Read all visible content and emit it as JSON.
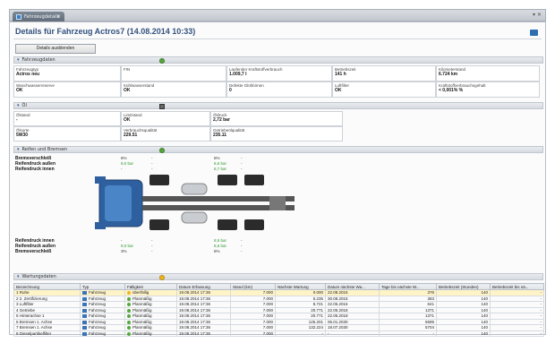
{
  "tab": {
    "label": "Fahrzeugdetails"
  },
  "header": {
    "title": "Details für Fahrzeug Actros7 (14.08.2014 10:33)"
  },
  "toolbar": {
    "details_label": "Details ausblenden"
  },
  "sections": {
    "vehicle": "Fahrzeugdaten",
    "oil": "Öl",
    "tires": "Reifen und Bremsen",
    "maintenance": "Wartungsdaten"
  },
  "vehicle_cells": [
    {
      "label": "Fahrzeugtyp",
      "value": "Actros neu"
    },
    {
      "label": "FIN",
      "value": ""
    },
    {
      "label": "Laufender Kraftstoffverbrauch",
      "value": "1.009,7 l"
    },
    {
      "label": "Betriebszeit",
      "value": "141 h"
    },
    {
      "label": "Kilometerstand",
      "value": "6.724 km"
    },
    {
      "label": "Waschwasserreserve",
      "value": "OK"
    },
    {
      "label": "Kühlwasserstand",
      "value": "OK"
    },
    {
      "label": "Defekte Glühbirnen",
      "value": "0"
    },
    {
      "label": "Luftfilter",
      "value": "OK"
    },
    {
      "label": "Kraftstoffverbrauchsgehalt",
      "value": "< 0,001% %"
    }
  ],
  "oil_cells": [
    {
      "label": "Ölstand",
      "value": "-"
    },
    {
      "label": "Limitstand",
      "value": "OK"
    },
    {
      "label": "Öldruck",
      "value": "2,72 bar"
    },
    {
      "label": "Ölsorte",
      "value": "5W30"
    },
    {
      "label": "Verbrauchsqualität",
      "value": "229.51"
    },
    {
      "label": "Getriebeölqualität",
      "value": "235.11"
    }
  ],
  "tires_top": [
    {
      "label": "Bremsverschleiß",
      "v1": "6%",
      "v1_green": false,
      "v2": "-",
      "v3": "5%",
      "v3_green": false,
      "v4": "-"
    },
    {
      "label": "Reifendruck außen",
      "v1": "8,0 bar",
      "v1_green": true,
      "v2": "-",
      "v3": "8,6 bar",
      "v3_green": true,
      "v4": "-"
    },
    {
      "label": "Reifendruck innen",
      "v1": "-",
      "v1_green": false,
      "v2": "-",
      "v3": "8,7 bar",
      "v3_green": true,
      "v4": "-"
    }
  ],
  "tires_bottom": [
    {
      "label": "Reifendruck innen",
      "v1": "-",
      "v1_green": false,
      "v2": "-",
      "v3": "8,5 bar",
      "v3_green": true,
      "v4": "-"
    },
    {
      "label": "Reifendruck außen",
      "v1": "9,0 bar",
      "v1_green": true,
      "v2": "-",
      "v3": "8,6 bar",
      "v3_green": true,
      "v4": "-"
    },
    {
      "label": "Bremsverschleiß",
      "v1": "3%",
      "v1_green": false,
      "v2": "-",
      "v3": "6%",
      "v3_green": false,
      "v4": "-"
    }
  ],
  "maintenance": {
    "columns": [
      "Bezeichnung",
      "Typ",
      "Fälligkeit",
      "Datum Erfassung",
      "Stand (km)",
      "Nächste Wartung",
      "Datum nächste Wa...",
      "Tage bis nächste W...",
      "Betriebszeit (Stunden)",
      "Betriebszeit bis nä..."
    ],
    "rows": [
      {
        "name": "Ruhe",
        "type": "Fahrzeug",
        "status": "überfällig",
        "warn": true,
        "date": "19.08.2014 17:36",
        "km": "7.000",
        "next": "0.000",
        "next_date": "22.08.2015",
        "days": "376",
        "hours": "140",
        "hours_left": "-"
      },
      {
        "name": "2. Zertifizierung",
        "type": "Fahrzeug",
        "status": "Planmäßig",
        "warn": false,
        "date": "19.08.2014 17:36",
        "km": "7.000",
        "next": "5.235",
        "next_date": "30.08.2015",
        "days": "383",
        "hours": "140",
        "hours_left": "-"
      },
      {
        "name": "Luftfilter",
        "type": "Fahrzeug",
        "status": "Planmäßig",
        "warn": false,
        "date": "19.08.2014 17:36",
        "km": "7.000",
        "next": "8.721",
        "next_date": "22.05.2016",
        "days": "641",
        "hours": "140",
        "hours_left": "-"
      },
      {
        "name": "Getriebe",
        "type": "Fahrzeug",
        "status": "Planmäßig",
        "warn": false,
        "date": "19.08.2014 17:36",
        "km": "7.000",
        "next": "20.771",
        "next_date": "22.05.2018",
        "days": "1371",
        "hours": "140",
        "hours_left": "-"
      },
      {
        "name": "Hinterachse 1",
        "type": "Fahrzeug",
        "status": "Planmäßig",
        "warn": false,
        "date": "19.08.2014 17:36",
        "km": "7.000",
        "next": "20.771",
        "next_date": "22.05.2018",
        "days": "1371",
        "hours": "140",
        "hours_left": "-"
      },
      {
        "name": "Bremsen 1. Achse",
        "type": "Fahrzeug",
        "status": "Planmäßig",
        "warn": false,
        "date": "19.08.2014 17:36",
        "km": "7.000",
        "next": "125.201",
        "next_date": "06.01.2030",
        "days": "5595",
        "hours": "140",
        "hours_left": "-"
      },
      {
        "name": "Bremsen 1. Achse",
        "type": "Fahrzeug",
        "status": "Planmäßig",
        "warn": false,
        "date": "19.08.2014 17:36",
        "km": "7.000",
        "next": "132.224",
        "next_date": "18.07.2030",
        "days": "5704",
        "hours": "140",
        "hours_left": "-"
      },
      {
        "name": "Dieselpartikelfilter",
        "type": "Fahrzeug",
        "status": "Planmäßig",
        "warn": false,
        "date": "19.08.2014 17:36",
        "km": "7.000",
        "next": "-",
        "next_date": "-",
        "days": "-",
        "hours": "140",
        "hours_left": "-"
      }
    ]
  },
  "colors": {
    "accent": "#33527f",
    "ok": "#53a83b",
    "warn": "#f1b51c",
    "truck_cab": "#2e5f9e"
  }
}
